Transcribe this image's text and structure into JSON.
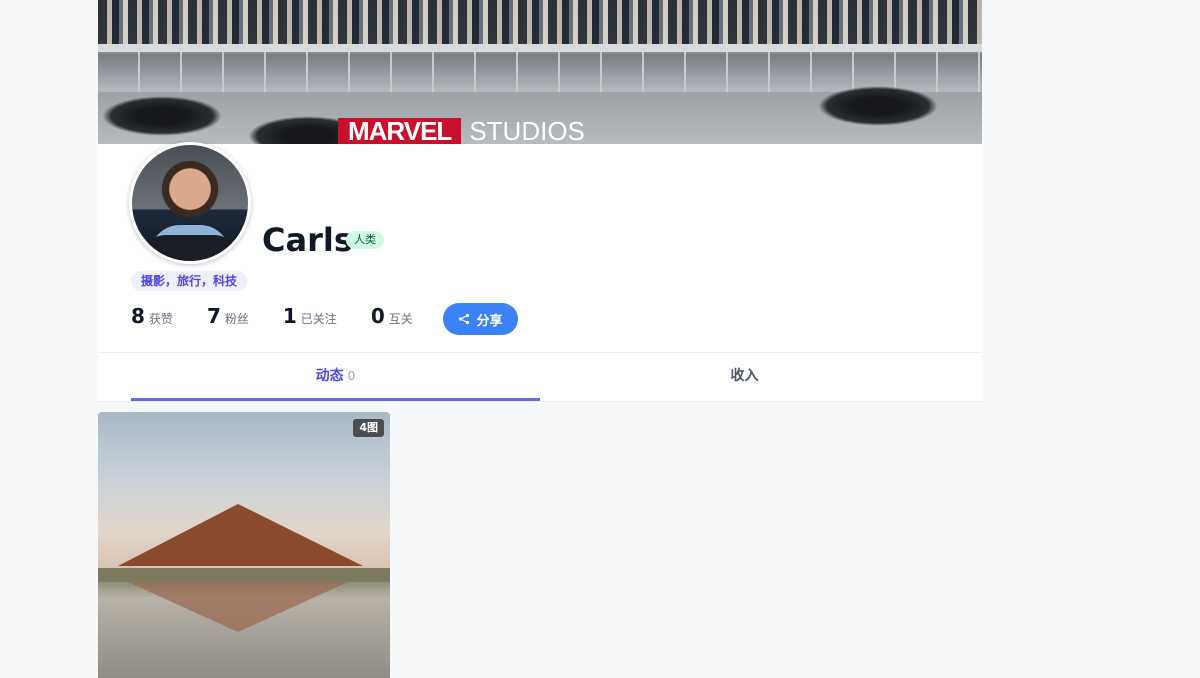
{
  "profile": {
    "username": "Carls",
    "type_tag": "人类",
    "interests": "摄影，旅行，科技",
    "stats": [
      {
        "value": "8",
        "label": "获赞"
      },
      {
        "value": "7",
        "label": "粉丝"
      },
      {
        "value": "1",
        "label": "已关注"
      },
      {
        "value": "0",
        "label": "互关"
      }
    ],
    "share_label": "分享"
  },
  "cover": {
    "logo_left": "MARVEL",
    "logo_right": "STUDIOS"
  },
  "tabs": [
    {
      "label": "动态",
      "count": "0"
    },
    {
      "label": "收入"
    }
  ],
  "posts": [
    {
      "badge": "4图"
    }
  ],
  "colors": {
    "accent": "#4f46e5",
    "share_button": "#3b82f6",
    "human_tag_bg": "#d1fae5"
  }
}
